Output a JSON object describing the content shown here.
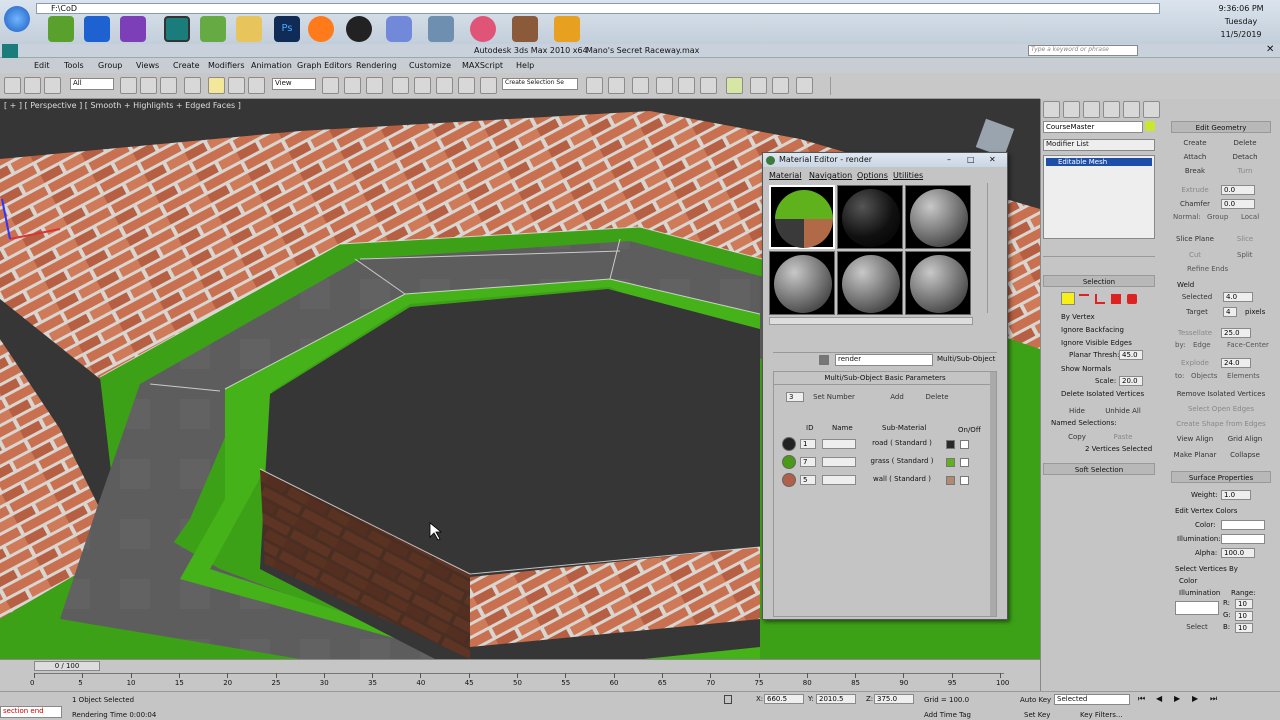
{
  "os": {
    "address": "F:\\CoD",
    "clock_time": "9:36:06 PM",
    "clock_day": "Tuesday",
    "clock_date": "11/5/2019"
  },
  "app": {
    "title": "Autodesk 3ds Max 2010 x64",
    "file": "Mano's Secret Raceway.max",
    "search_placeholder": "Type a keyword or phrase"
  },
  "menu": [
    "Edit",
    "Tools",
    "Group",
    "Views",
    "Create",
    "Modifiers",
    "Animation",
    "Graph Editors",
    "Rendering",
    "Customize",
    "MAXScript",
    "Help"
  ],
  "toolbar": {
    "selection_filter": "All",
    "ref_coord": "View",
    "named_selection": "Create Selection Se"
  },
  "viewport": {
    "label": "[ + ] [ Perspective ] [ Smooth + Highlights + Edged Faces ]"
  },
  "material_editor": {
    "title": "Material Editor - render",
    "menus": [
      "Material",
      "Navigation",
      "Options",
      "Utilities"
    ],
    "material_name": "render",
    "material_type": "Multi/Sub-Object",
    "rollout": "Multi/Sub-Object Basic Parameters",
    "count": "3",
    "set_number": "Set Number",
    "add": "Add",
    "delete": "Delete",
    "col_id": "ID",
    "col_name": "Name",
    "col_sub": "Sub-Material",
    "col_onoff": "On/Off",
    "rows": [
      {
        "id": "1",
        "sub": "road  ( Standard )",
        "color": "#2a2a2a"
      },
      {
        "id": "7",
        "sub": "grass  ( Standard )",
        "color": "#5fb21c"
      },
      {
        "id": "5",
        "sub": "wall  ( Standard )",
        "color": "#b08a70"
      }
    ]
  },
  "command_panel": {
    "object_name": "CourseMaster",
    "modifier_list": "Modifier List",
    "stack_item": "Editable Mesh",
    "selection": "Selection",
    "by_vertex": "By Vertex",
    "ignore_backfacing": "Ignore Backfacing",
    "ignore_visible_edges": "Ignore Visible Edges",
    "planar_thresh": "Planar Thresh:",
    "planar_val": "45.0",
    "show_normals": "Show Normals",
    "scale": "Scale:",
    "scale_val": "20.0",
    "delete_isolated": "Delete Isolated Vertices",
    "hide": "Hide",
    "unhide_all": "Unhide All",
    "named_selections": "Named Selections:",
    "copy": "Copy",
    "paste": "Paste",
    "vertices_selected": "2 Vertices Selected",
    "soft_selection": "Soft Selection",
    "edit_geometry": "Edit Geometry",
    "create": "Create",
    "delete": "Delete",
    "attach": "Attach",
    "detach": "Detach",
    "break": "Break",
    "turn": "Turn",
    "extrude": "Extrude",
    "extrude_val": "0.0",
    "chamfer": "Chamfer",
    "chamfer_val": "0.0",
    "normal": "Normal:",
    "group": "Group",
    "local": "Local",
    "slice_plane": "Slice Plane",
    "slice": "Slice",
    "cut": "Cut",
    "split": "Split",
    "refine_ends": "Refine Ends",
    "weld": "Weld",
    "selected": "Selected",
    "selected_val": "4.0",
    "target": "Target",
    "target_val": "4",
    "pixels": "pixels",
    "tessellate": "Tessellate",
    "tess_val": "25.0",
    "by": "by:",
    "edge": "Edge",
    "face_center": "Face-Center",
    "explode": "Explode",
    "explode_val": "24.0",
    "to": "to:",
    "objects": "Objects",
    "elements": "Elements",
    "remove_isolated": "Remove Isolated Vertices",
    "select_open_edges": "Select Open Edges",
    "create_shape": "Create Shape from Edges",
    "view_align": "View Align",
    "grid_align": "Grid Align",
    "make_planar": "Make Planar",
    "collapse": "Collapse",
    "surface_properties": "Surface Properties",
    "weight": "Weight:",
    "weight_val": "1.0",
    "edit_vertex_colors": "Edit Vertex Colors",
    "color": "Color:",
    "illumination": "Illumination:",
    "alpha": "Alpha:",
    "alpha_val": "100.0",
    "select_vertices_by": "Select Vertices By",
    "color_radio": "Color",
    "illum_radio": "Illumination",
    "range": "Range:",
    "r": "R:",
    "g": "G:",
    "b": "B:",
    "range_val": "10",
    "select_btn": "Select"
  },
  "timeline": {
    "frame": "0 / 100",
    "ticks": [
      "0",
      "5",
      "10",
      "15",
      "20",
      "25",
      "30",
      "35",
      "40",
      "45",
      "50",
      "55",
      "60",
      "65",
      "70",
      "75",
      "80",
      "85",
      "90",
      "95",
      "100"
    ]
  },
  "status": {
    "maxscript": "section end",
    "selected": "1 Object Selected",
    "render_time": "Rendering Time 0:00:04",
    "x": "660.5",
    "y": "2010.5",
    "z": "375.0",
    "grid": "Grid = 100.0",
    "add_time_tag": "Add Time Tag",
    "auto_key": "Auto Key",
    "set_key": "Set Key",
    "key_mode": "Selected",
    "key_filters": "Key Filters..."
  }
}
